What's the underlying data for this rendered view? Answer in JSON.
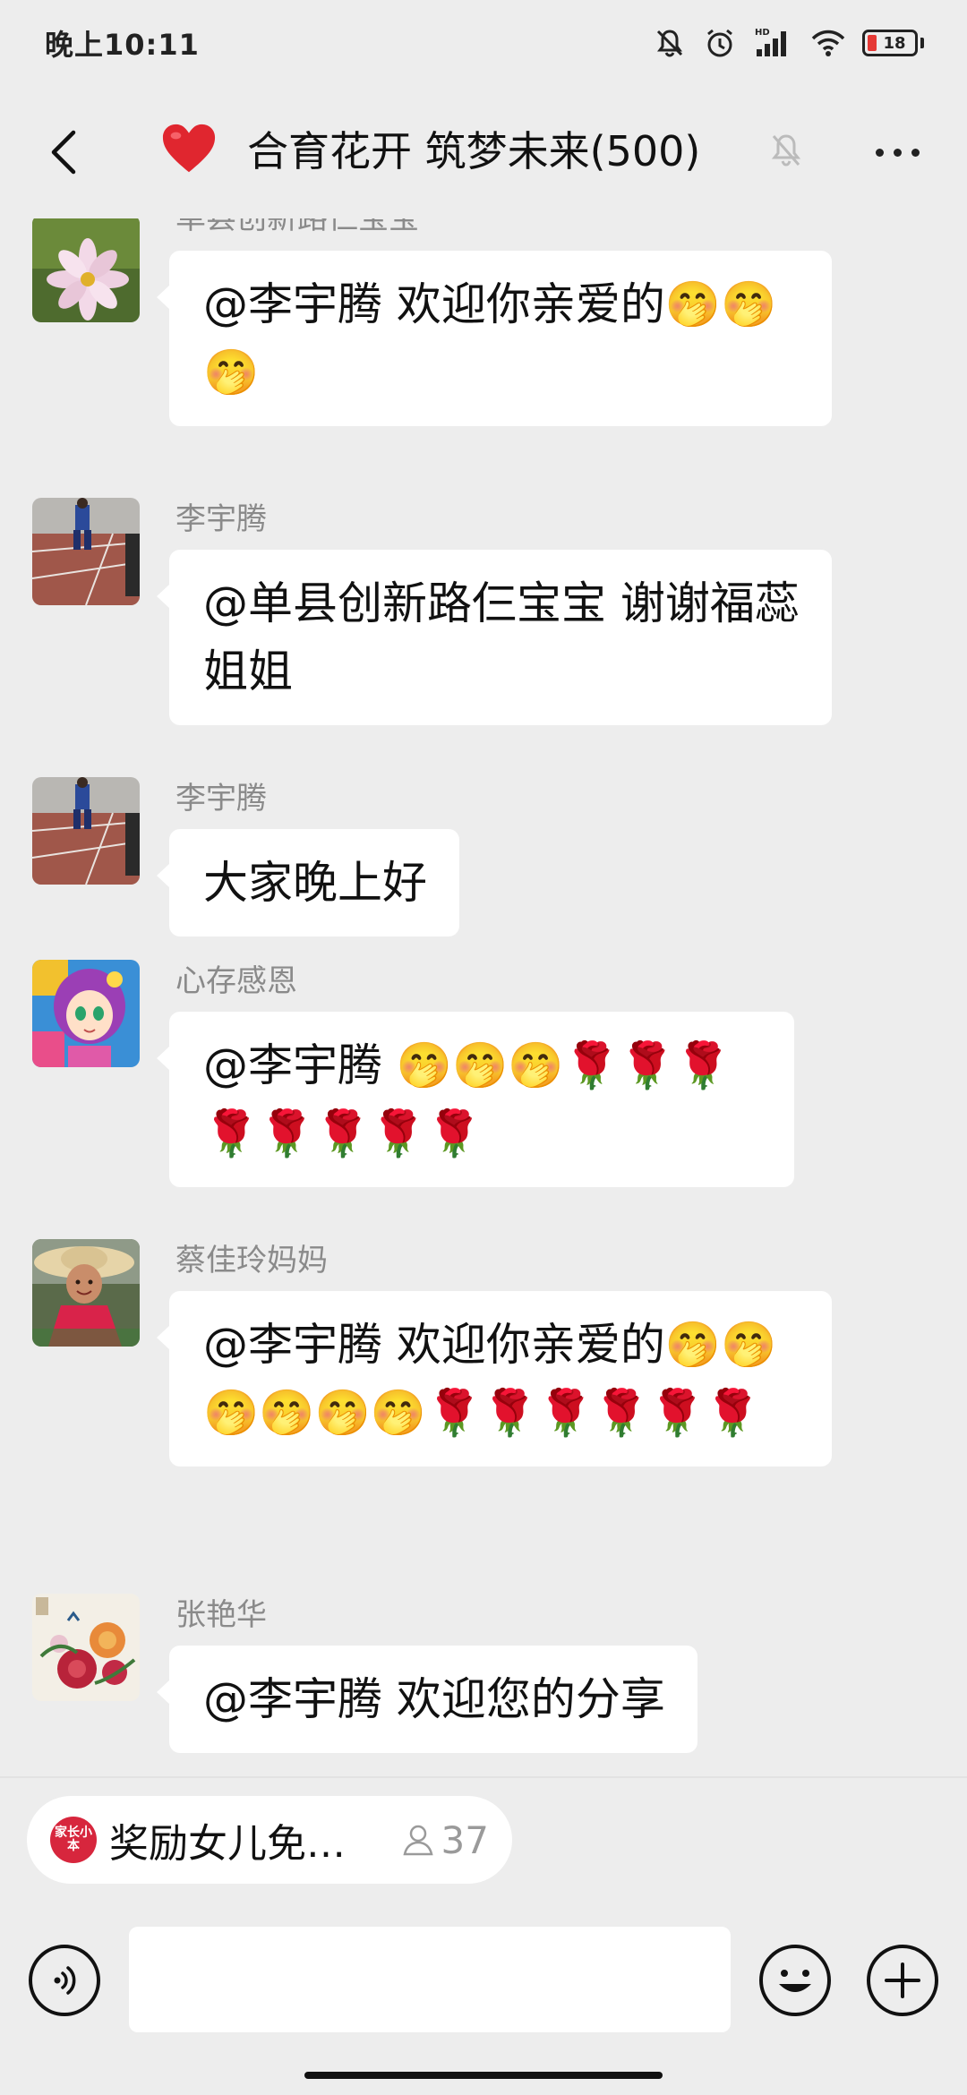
{
  "status_bar": {
    "time": "晚上10:11",
    "network_label": "HD",
    "battery_level": "18",
    "battery_color": "#e53935"
  },
  "header": {
    "title": "合育花开 筑梦未来(500)",
    "emoji": "❤️",
    "icons": [
      "back-arrow-icon",
      "heart-icon",
      "mute-bell-icon",
      "more-icon"
    ]
  },
  "messages": [
    {
      "sender": "单县创新路仨宝宝",
      "text": "@李宇腾 欢迎你亲爱的🤭🤭🤭",
      "avatar": "cosmos-flower-avatar"
    },
    {
      "sender": "李宇腾",
      "text": "@单县创新路仨宝宝 谢谢福蕊姐姐",
      "avatar": "running-track-avatar"
    },
    {
      "sender": "李宇腾",
      "text": "大家晚上好",
      "avatar": "running-track-avatar"
    },
    {
      "sender": "心存感恩",
      "text": "@李宇腾 🤭🤭🤭🌹🌹🌹🌹🌹🌹🌹🌹",
      "avatar": "cartoon-girl-avatar"
    },
    {
      "sender": "蔡佳玲妈妈",
      "text": "@李宇腾 欢迎你亲爱的🤭🤭🤭🤭🤭🤭🌹🌹🌹🌹🌹🌹",
      "avatar": "straw-hat-avatar"
    },
    {
      "sender": "张艳华",
      "text": "@李宇腾 欢迎您的分享",
      "avatar": "peony-painting-avatar"
    }
  ],
  "mini_app_chip": {
    "logo_text": "家长小本",
    "title": "奖励女儿免…",
    "count": "37"
  },
  "input_bar": {
    "placeholder": "",
    "value": ""
  }
}
